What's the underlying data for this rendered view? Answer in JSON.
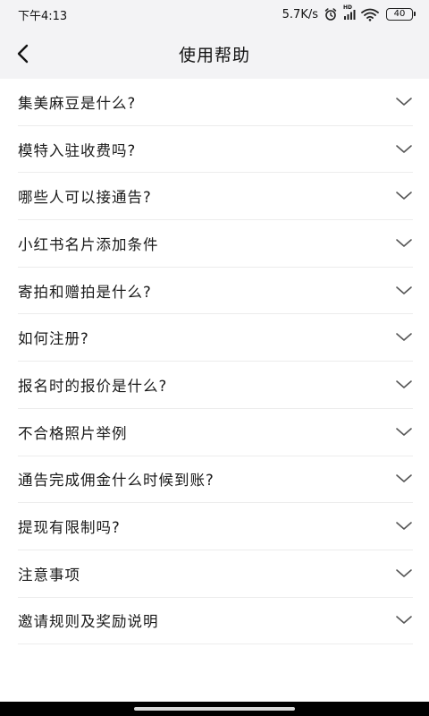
{
  "status_bar": {
    "time": "下午4:13",
    "network_speed": "5.7K/s",
    "hd_label": "HD",
    "battery": "40"
  },
  "header": {
    "title": "使用帮助"
  },
  "faq": {
    "items": [
      {
        "label": "集美麻豆是什么?"
      },
      {
        "label": "模特入驻收费吗?"
      },
      {
        "label": "哪些人可以接通告?"
      },
      {
        "label": "小红书名片添加条件"
      },
      {
        "label": "寄拍和赠拍是什么?"
      },
      {
        "label": "如何注册?"
      },
      {
        "label": "报名时的报价是什么?"
      },
      {
        "label": "不合格照片举例"
      },
      {
        "label": "通告完成佣金什么时候到账?"
      },
      {
        "label": "提现有限制吗?"
      },
      {
        "label": "注意事项"
      },
      {
        "label": "邀请规则及奖励说明"
      }
    ]
  }
}
